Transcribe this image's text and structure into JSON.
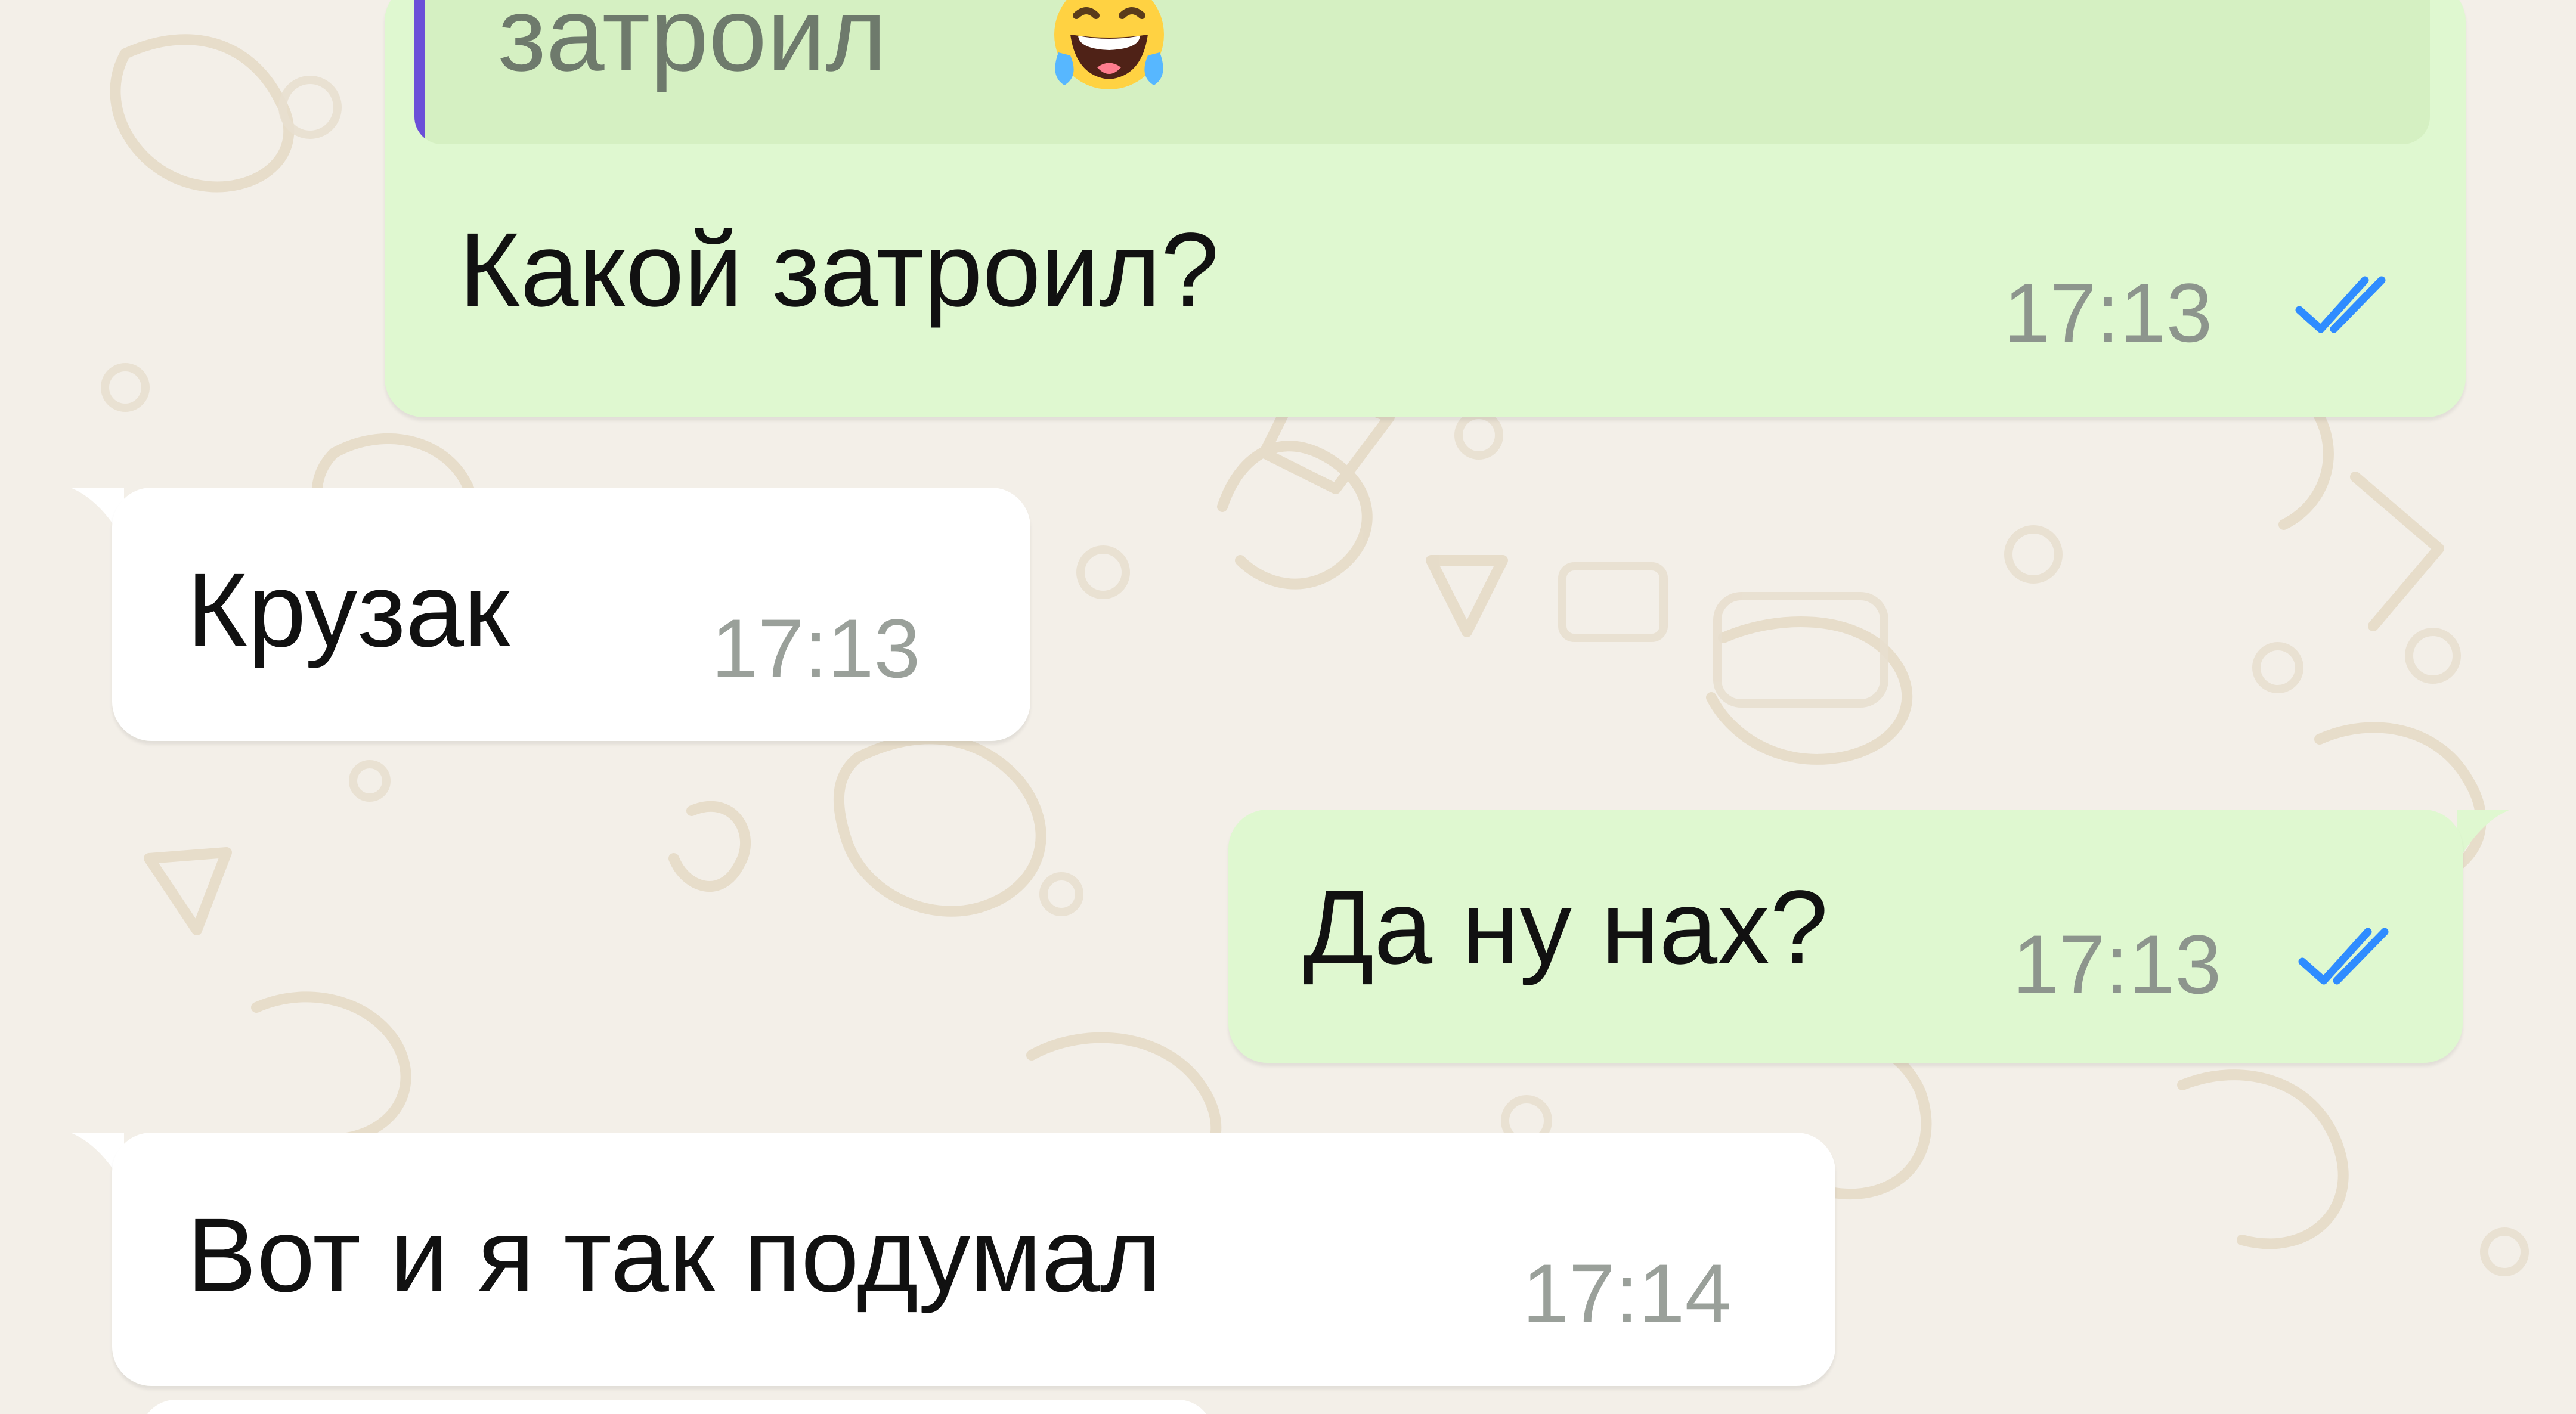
{
  "conversation": {
    "messages": [
      {
        "direction": "outgoing",
        "reply_to": {
          "quoted_text": "затроил",
          "emoji": "face-with-tears-of-joy-icon"
        },
        "text": "Какой затроил?",
        "time": "17:13",
        "status_icon": "double-check-read-icon"
      },
      {
        "direction": "incoming",
        "text": "Крузак",
        "time": "17:13"
      },
      {
        "direction": "outgoing",
        "text": "Да ну нах?",
        "time": "17:13",
        "status_icon": "double-check-read-icon"
      },
      {
        "direction": "incoming",
        "text": "Вот и я так подумал",
        "time": "17:14"
      }
    ]
  },
  "colors": {
    "background": "#f3efe8",
    "outgoing_bubble": "#dff8d0",
    "incoming_bubble": "#ffffff",
    "quote_bar": "#6b4fd8",
    "read_check": "#2f8cff"
  }
}
